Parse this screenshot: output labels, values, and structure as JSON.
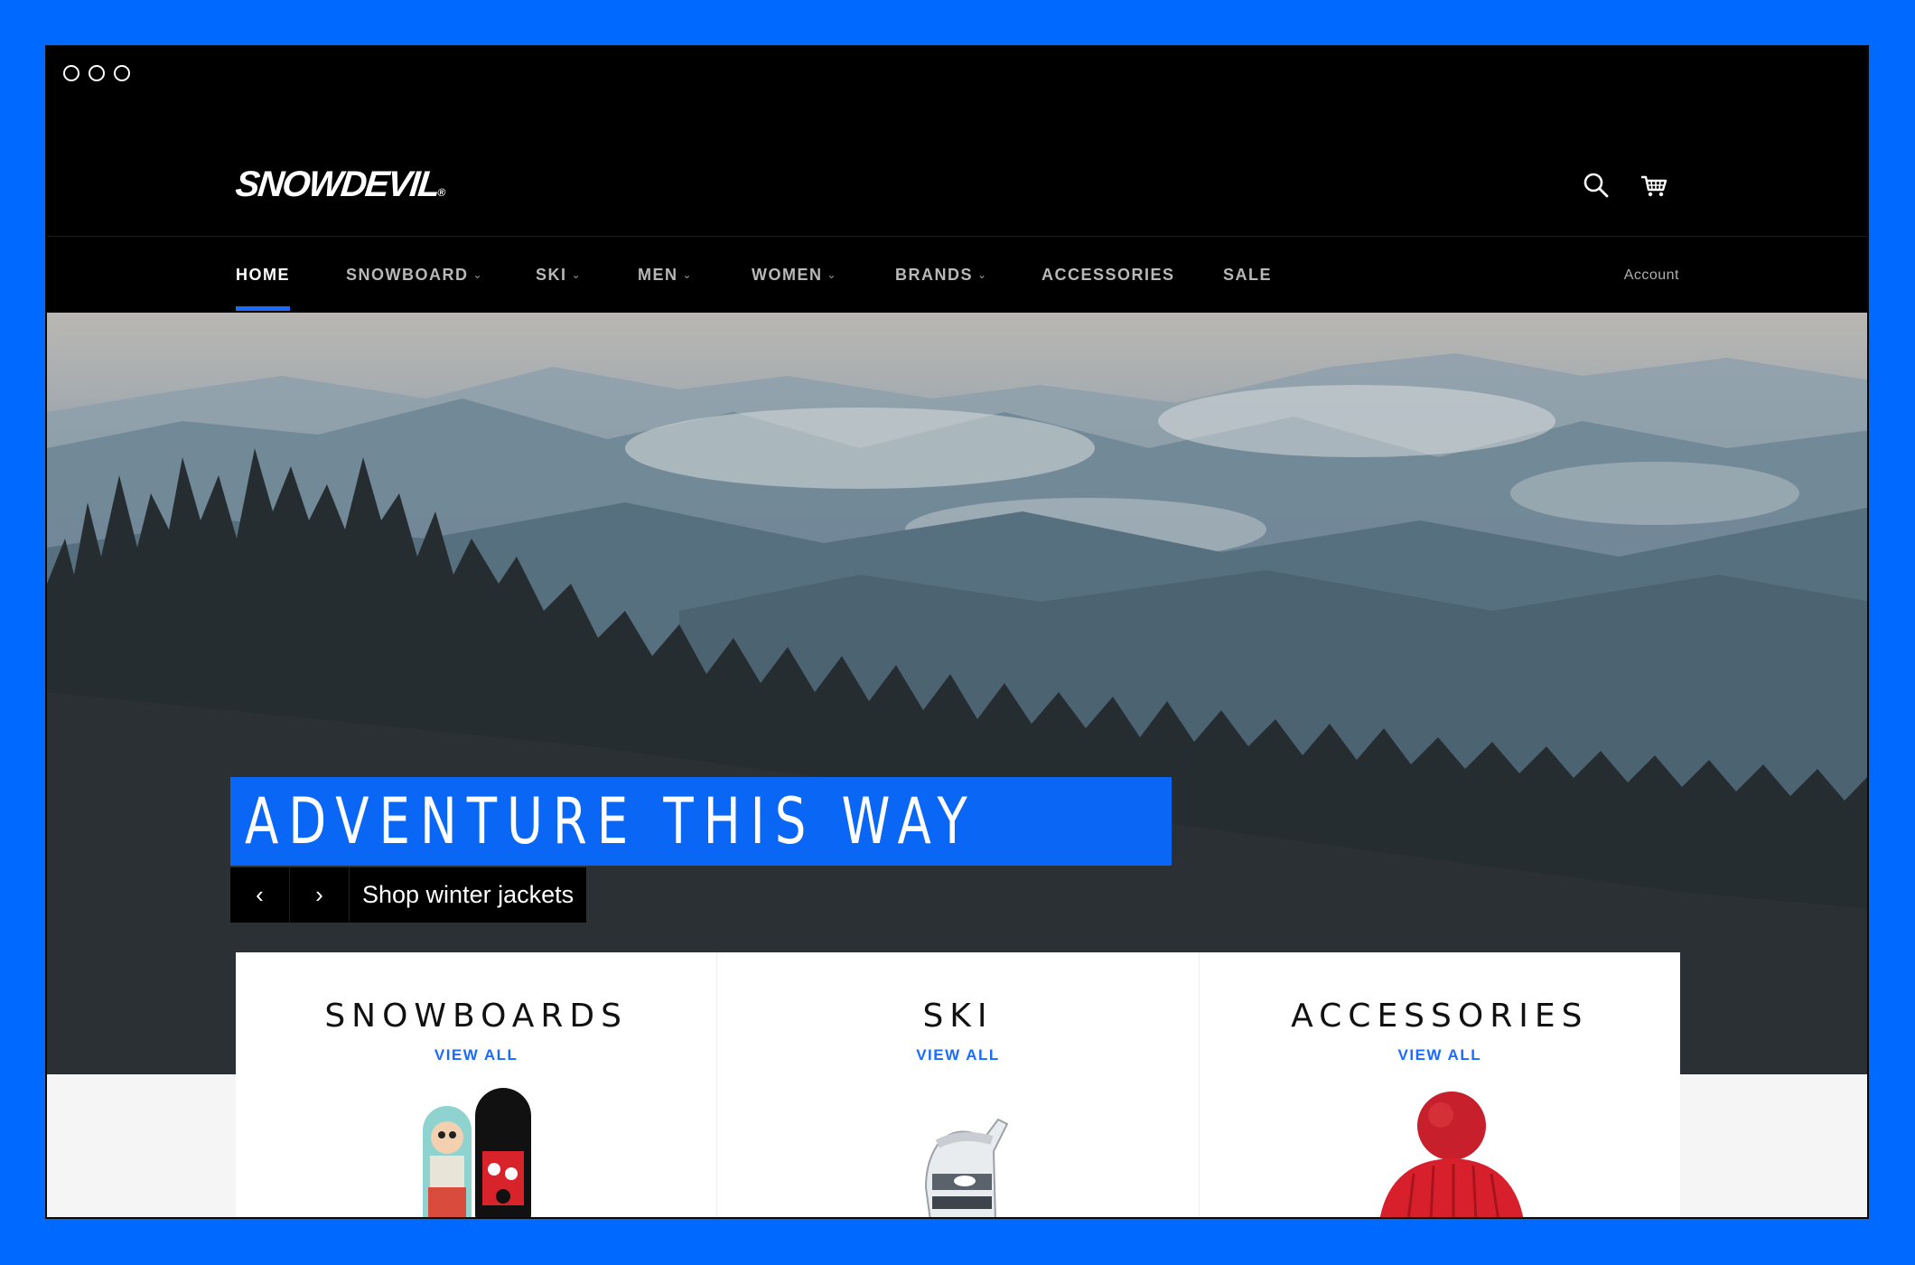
{
  "window": {
    "controls": [
      "window-dot",
      "window-dot",
      "window-dot"
    ]
  },
  "header": {
    "logo": "SNOWDEVIL",
    "logo_mark": "®",
    "icons": [
      "search-icon",
      "cart-icon"
    ]
  },
  "nav": {
    "items": [
      {
        "label": "HOME",
        "active": true,
        "dropdown": false
      },
      {
        "label": "SNOWBOARD",
        "active": false,
        "dropdown": true
      },
      {
        "label": "SKI",
        "active": false,
        "dropdown": true
      },
      {
        "label": "MEN",
        "active": false,
        "dropdown": true
      },
      {
        "label": "WOMEN",
        "active": false,
        "dropdown": true
      },
      {
        "label": "BRANDS",
        "active": false,
        "dropdown": true
      },
      {
        "label": "ACCESSORIES",
        "active": false,
        "dropdown": false
      },
      {
        "label": "SALE",
        "active": false,
        "dropdown": false
      }
    ],
    "account": "Account",
    "chevron": "⌄"
  },
  "hero": {
    "headline": "ADVENTURE THIS WAY",
    "prev": "‹",
    "next": "›",
    "cta": "Shop winter jackets",
    "accent_color": "#0a66f5"
  },
  "collections": [
    {
      "title": "SNOWBOARDS",
      "link": "VIEW ALL"
    },
    {
      "title": "SKI",
      "link": "VIEW ALL"
    },
    {
      "title": "ACCESSORIES",
      "link": "VIEW ALL"
    }
  ],
  "colors": {
    "frame": "#0069ff",
    "link": "#1a6bff",
    "header_bg": "#000000"
  }
}
